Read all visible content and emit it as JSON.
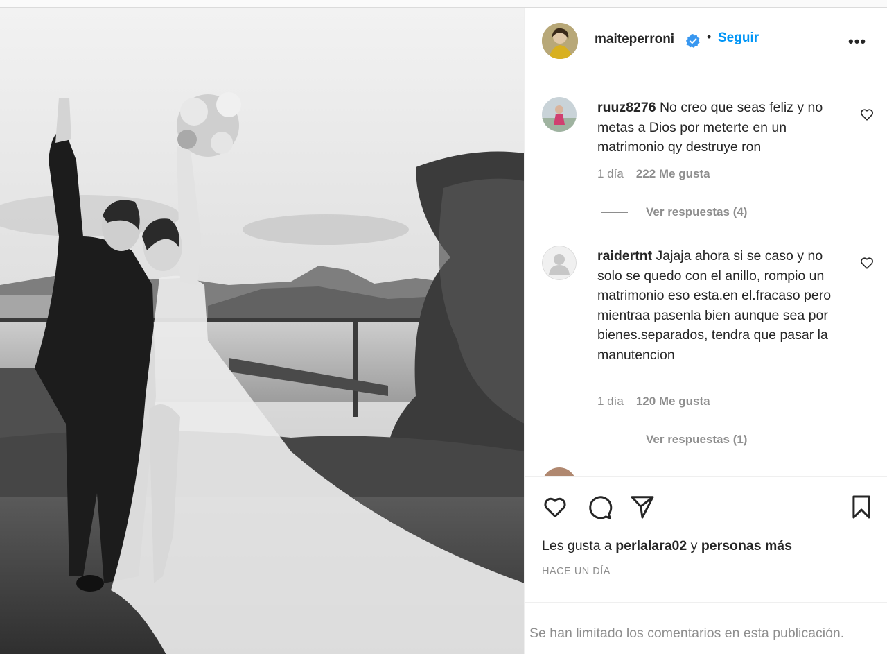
{
  "post": {
    "username": "maiteperroni",
    "follow_label": "Seguir",
    "dot": "•",
    "more_label": "•••"
  },
  "comments": [
    {
      "username": "ruuz8276",
      "text": "No creo que seas feliz y no metas a Dios por meterte en un matrimonio qy destruye ron",
      "time": "1 día",
      "likes": "222 Me gusta",
      "replies": "Ver respuestas (4)"
    },
    {
      "username": "raidertnt",
      "text": "Jajaja ahora si se caso y no solo se quedo con el anillo, rompio un matrimonio eso esta.en el.fracaso pero mientraa pasenla bien aunque sea por bienes.separados, tendra que pasar la manutencion",
      "time": "1 día",
      "likes": "120 Me gusta",
      "replies": "Ver respuestas (1)"
    }
  ],
  "actions": {
    "likes_prefix": "Les gusta a",
    "liked_by": "perlalara02",
    "likes_conj": "y",
    "likes_others": "personas más",
    "timestamp": "HACE UN DÍA",
    "limited_notice": "Se han limitado los comentarios en esta publicación."
  },
  "colors": {
    "accent": "#0095f6",
    "verified": "#3897f0",
    "muted": "#8e8e8e",
    "text": "#262626"
  },
  "icons": [
    "verified-badge-icon",
    "heart-outline-icon",
    "comment-icon",
    "share-plane-icon",
    "bookmark-icon",
    "more-dots-icon"
  ]
}
